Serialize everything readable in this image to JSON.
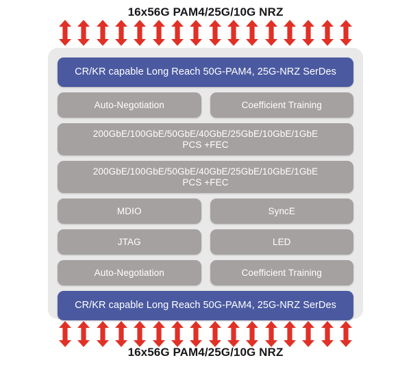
{
  "diagram": {
    "top_caption": "16x56G PAM4/25G/10G NRZ",
    "bottom_caption": "16x56G PAM4/25G/10G NRZ",
    "arrow_count": 16,
    "arrow_direction": "bidirectional-vertical",
    "arrow_icon": "double-headed-vertical-arrow-icon",
    "colors": {
      "arrow": "#e03127",
      "serdes_block": "#4b5aa0",
      "gray_block": "#a5a1a0",
      "container": "#e9e9e9",
      "block_text": "#ffffff",
      "caption_text": "#17171a",
      "page_background": "#ffffff"
    },
    "rows": [
      {
        "id": "serdes-top",
        "blocks": [
          {
            "label": "CR/KR capable Long Reach 50G-PAM4, 25G-NRZ SerDes",
            "style": "serdes"
          }
        ]
      },
      {
        "id": "autoneg-coeff-top",
        "blocks": [
          {
            "label": "Auto-Negotiation",
            "style": "gray"
          },
          {
            "label": "Coefficient Training",
            "style": "gray"
          }
        ]
      },
      {
        "id": "pcs-fec-1",
        "blocks": [
          {
            "label": "200GbE/100GbE/50GbE/40GbE/25GbE/10GbE/1GbE",
            "label2": "PCS +FEC",
            "style": "gray-tall"
          }
        ]
      },
      {
        "id": "pcs-fec-2",
        "blocks": [
          {
            "label": "200GbE/100GbE/50GbE/40GbE/25GbE/10GbE/1GbE",
            "label2": "PCS +FEC",
            "style": "gray-tall"
          }
        ]
      },
      {
        "id": "mdio-synce",
        "blocks": [
          {
            "label": "MDIO",
            "style": "gray"
          },
          {
            "label": "SyncE",
            "style": "gray"
          }
        ]
      },
      {
        "id": "jtag-led",
        "blocks": [
          {
            "label": "JTAG",
            "style": "gray"
          },
          {
            "label": "LED",
            "style": "gray"
          }
        ]
      },
      {
        "id": "autoneg-coeff-bottom",
        "blocks": [
          {
            "label": "Auto-Negotiation",
            "style": "gray"
          },
          {
            "label": "Coefficient Training",
            "style": "gray"
          }
        ]
      },
      {
        "id": "serdes-bottom",
        "blocks": [
          {
            "label": "CR/KR capable Long Reach 50G-PAM4, 25G-NRZ SerDes",
            "style": "serdes"
          }
        ]
      }
    ]
  }
}
